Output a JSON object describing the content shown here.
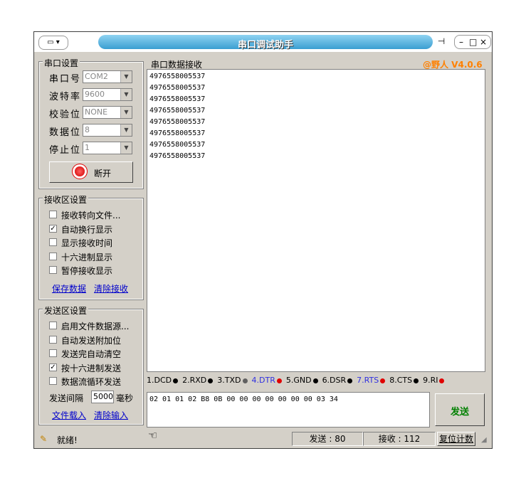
{
  "window": {
    "title": "串口调试助手",
    "version": "@野人 V4.0.6"
  },
  "serial_settings": {
    "title": "串口设置",
    "fields": [
      {
        "label": "串口号",
        "value": "COM2"
      },
      {
        "label": "波特率",
        "value": "9600"
      },
      {
        "label": "校验位",
        "value": "NONE"
      },
      {
        "label": "数据位",
        "value": "8"
      },
      {
        "label": "停止位",
        "value": "1"
      }
    ],
    "button": "断开"
  },
  "receive_settings": {
    "title": "接收区设置",
    "options": [
      {
        "label": "接收转向文件...",
        "checked": false
      },
      {
        "label": "自动换行显示",
        "checked": true
      },
      {
        "label": "显示接收时间",
        "checked": false
      },
      {
        "label": "十六进制显示",
        "checked": false
      },
      {
        "label": "暂停接收显示",
        "checked": false
      }
    ],
    "save_link": "保存数据",
    "clear_link": "清除接收"
  },
  "send_settings": {
    "title": "发送区设置",
    "options": [
      {
        "label": "启用文件数据源...",
        "checked": false
      },
      {
        "label": "自动发送附加位",
        "checked": false
      },
      {
        "label": "发送完自动清空",
        "checked": false
      },
      {
        "label": "按十六进制发送",
        "checked": true
      },
      {
        "label": "数据流循环发送",
        "checked": false
      }
    ],
    "interval_label": "发送间隔",
    "interval_value": "5000",
    "interval_unit": "毫秒",
    "load_link": "文件载入",
    "clear_link": "清除输入"
  },
  "receive_area": {
    "title": "串口数据接收",
    "lines": [
      "4976558005537",
      "4976558005537",
      "4976558005537",
      "4976558005537",
      "4976558005537",
      "4976558005537",
      "4976558005537",
      "4976558005537"
    ]
  },
  "pins": [
    {
      "label": "1.DCD",
      "color": "#000000",
      "highlight": false
    },
    {
      "label": "2.RXD",
      "color": "#000000",
      "highlight": false
    },
    {
      "label": "3.TXD",
      "color": "#606060",
      "highlight": false
    },
    {
      "label": "4.DTR",
      "color": "#e00000",
      "highlight": true
    },
    {
      "label": "5.GND",
      "color": "#000000",
      "highlight": false
    },
    {
      "label": "6.DSR",
      "color": "#000000",
      "highlight": false
    },
    {
      "label": "7.RTS",
      "color": "#e00000",
      "highlight": true
    },
    {
      "label": "8.CTS",
      "color": "#000000",
      "highlight": false
    },
    {
      "label": "9.RI",
      "color": "#e00000",
      "highlight": false
    }
  ],
  "send_area": {
    "text": "02 01 01 02 B8 0B 00 00 00 00 00 00 00 03 34",
    "button": "发送"
  },
  "status": {
    "ready": "就绪!",
    "sent": "发送 : 80",
    "received": "接收 : 112",
    "reset": "复位计数"
  }
}
